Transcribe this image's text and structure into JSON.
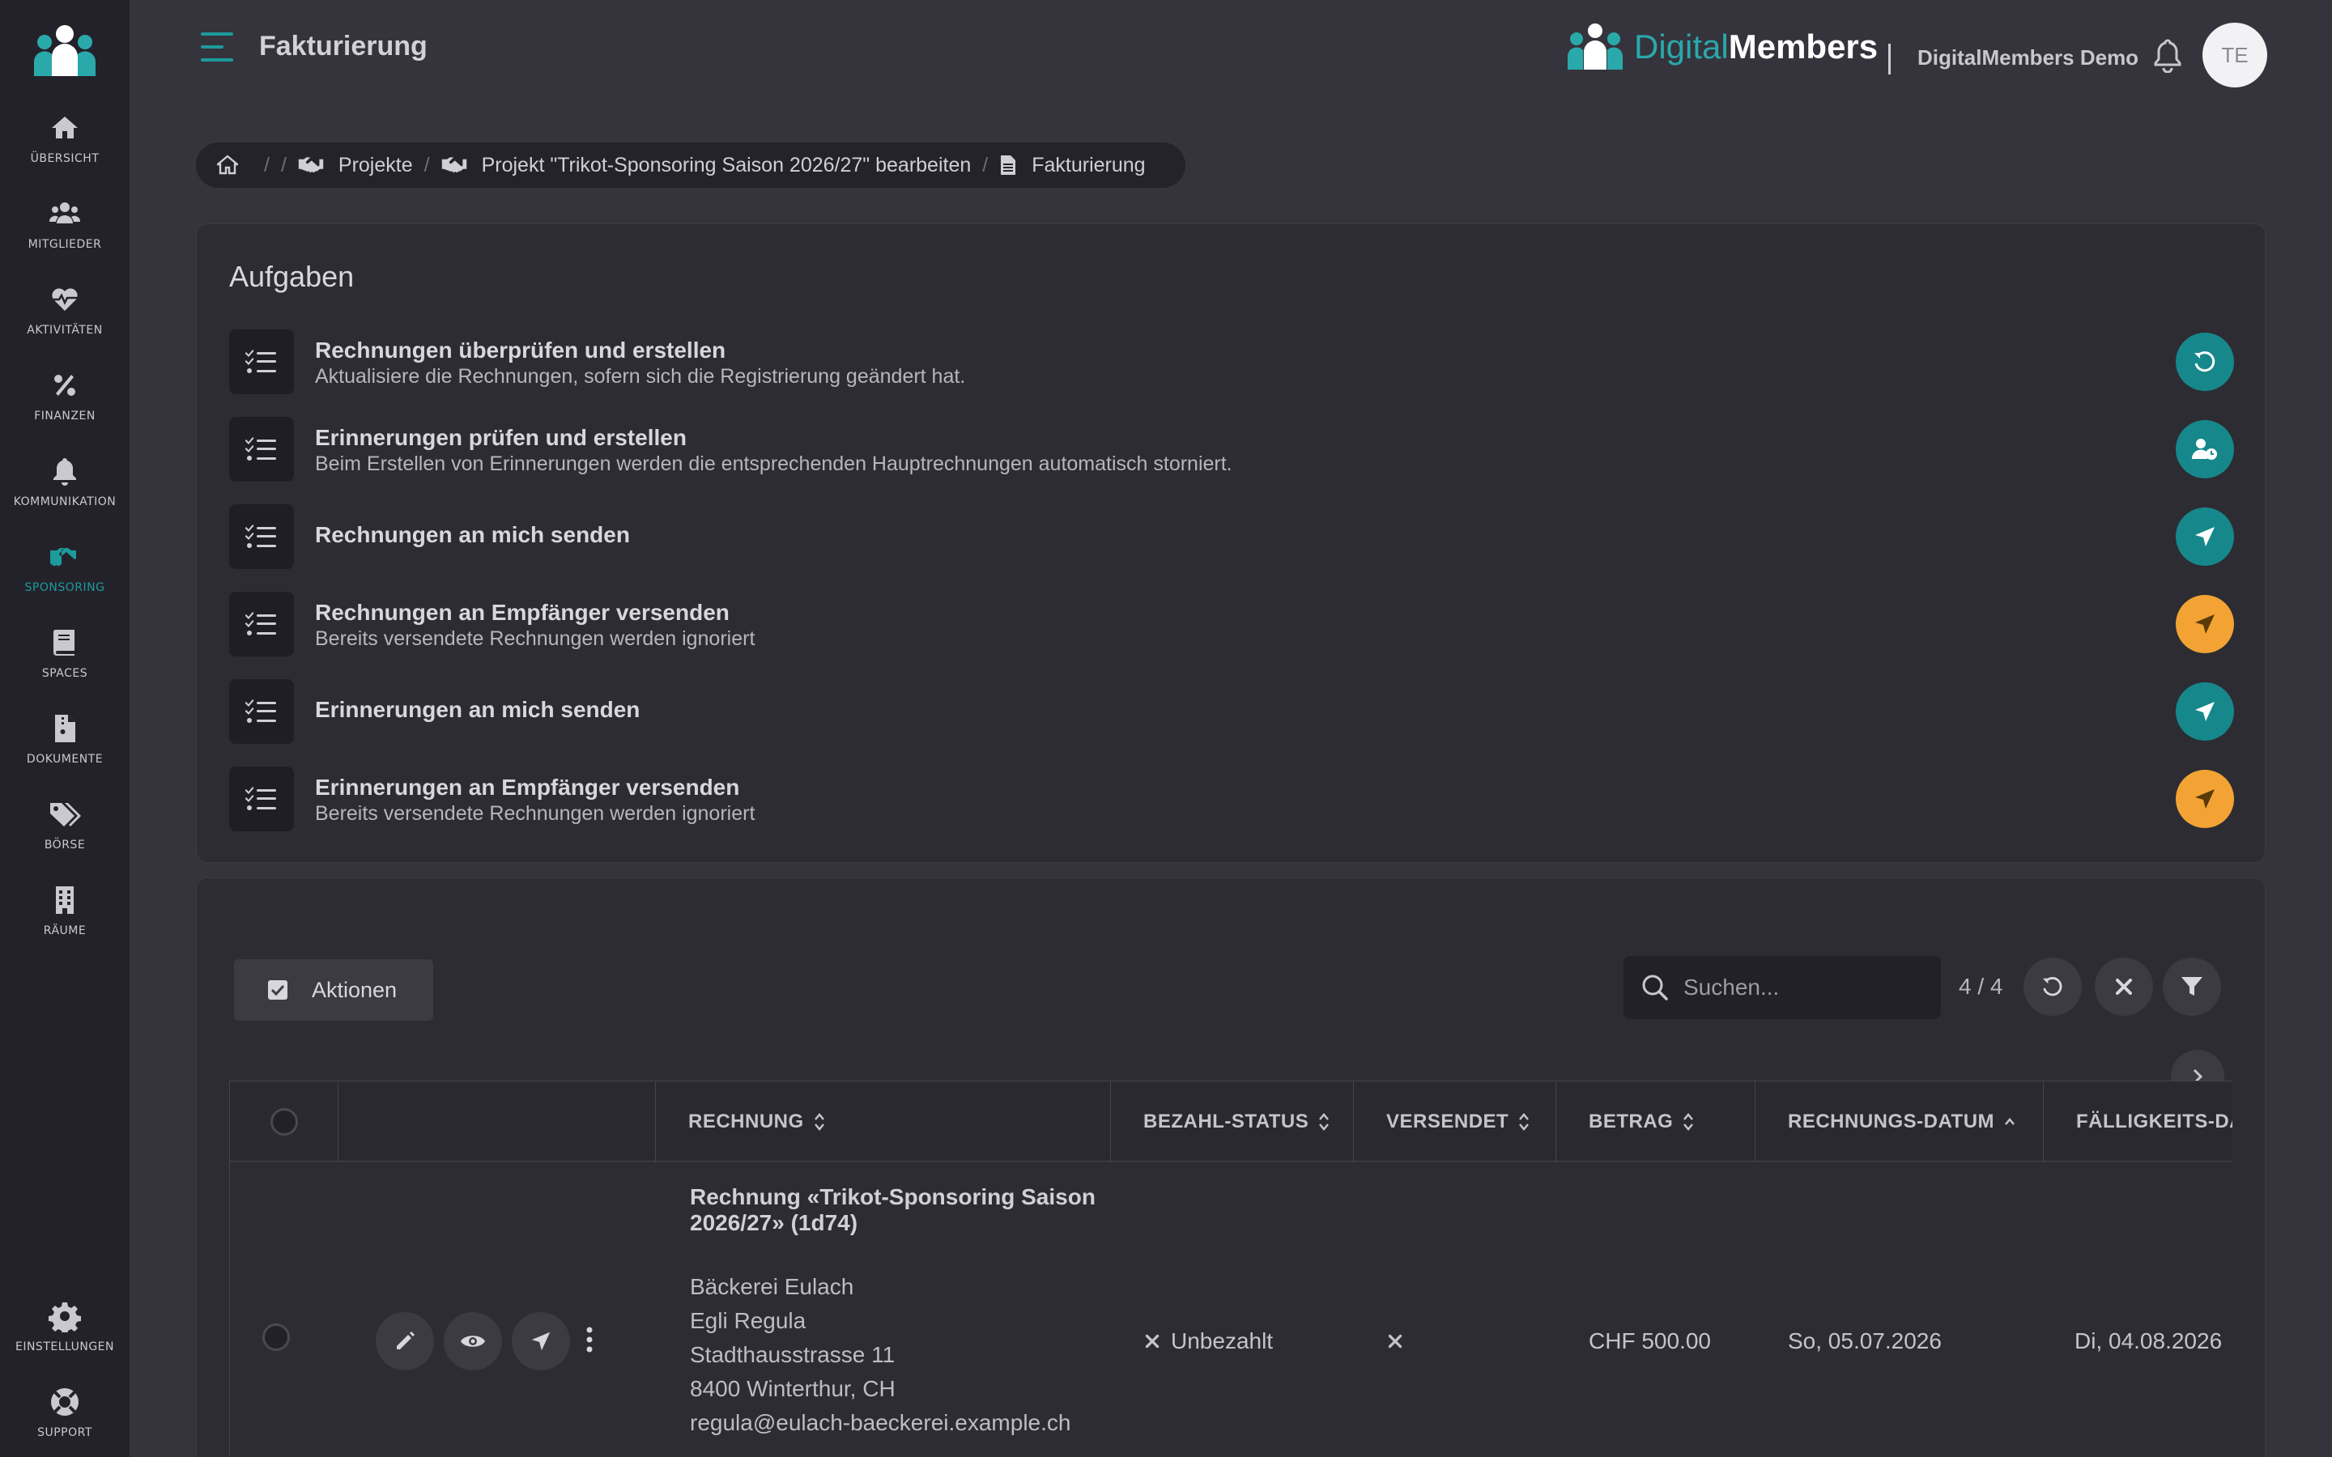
{
  "header": {
    "title": "Fakturierung",
    "brand_digital": "Digital",
    "brand_members": "Members",
    "org_name": "DigitalMembers Demo",
    "avatar_initials": "TE"
  },
  "sidebar": {
    "items": [
      {
        "label": "Übersicht",
        "icon": "home-icon"
      },
      {
        "label": "Mitglieder",
        "icon": "users-icon"
      },
      {
        "label": "Aktivitäten",
        "icon": "heartbeat-icon"
      },
      {
        "label": "Finanzen",
        "icon": "percent-icon"
      },
      {
        "label": "Kommunikation",
        "icon": "bell-icon"
      },
      {
        "label": "Sponsoring",
        "icon": "handshake-icon",
        "active": true
      },
      {
        "label": "Spaces",
        "icon": "book-icon"
      },
      {
        "label": "Dokumente",
        "icon": "file-icon"
      },
      {
        "label": "Börse",
        "icon": "tags-icon"
      },
      {
        "label": "Räume",
        "icon": "building-icon"
      },
      {
        "label": "Einstellungen",
        "icon": "gear-icon"
      },
      {
        "label": "Support",
        "icon": "lifebuoy-icon"
      }
    ],
    "active_color": "#1d9a9c"
  },
  "breadcrumb": {
    "items": [
      "Projekte",
      "Projekt \"Trikot-Sponsoring Saison 2026/27\" bearbeiten",
      "Fakturierung"
    ]
  },
  "tasks": {
    "title": "Aufgaben",
    "items": [
      {
        "title": "Rechnungen überprüfen und erstellen",
        "subtitle": "Aktualisiere die Rechnungen, sofern sich die Registrierung geändert hat.",
        "action_icon": "refresh-icon",
        "color": "#16888b"
      },
      {
        "title": "Erinnerungen prüfen und erstellen",
        "subtitle": "Beim Erstellen von Erinnerungen werden die entsprechenden Hauptrechnungen automatisch storniert.",
        "action_icon": "user-clock-icon",
        "color": "#16888b"
      },
      {
        "title": "Rechnungen an mich senden",
        "subtitle": "",
        "action_icon": "send-icon",
        "color": "#16888b"
      },
      {
        "title": "Rechnungen an Empfänger versenden",
        "subtitle": "Bereits versendete Rechnungen werden ignoriert",
        "action_icon": "send-icon",
        "color": "#f3a334"
      },
      {
        "title": "Erinnerungen an mich senden",
        "subtitle": "",
        "action_icon": "send-icon",
        "color": "#16888b"
      },
      {
        "title": "Erinnerungen an Empfänger versenden",
        "subtitle": "Bereits versendete Rechnungen werden ignoriert",
        "action_icon": "send-icon",
        "color": "#f3a334"
      }
    ]
  },
  "table": {
    "actions_label": "Aktionen",
    "search_placeholder": "Suchen...",
    "count": "4 / 4",
    "columns": [
      "RECHNUNG",
      "BEZAHL-STATUS",
      "VERSENDET",
      "BETRAG",
      "RECHNUNGS-DATUM",
      "FÄLLIGKEITS-DAT"
    ],
    "rows": [
      {
        "title": "Rechnung «Trikot-Sponsoring Saison 2026/27» (1d74)",
        "address": [
          "Bäckerei Eulach",
          "Egli Regula",
          "Stadthausstrasse 11",
          "8400 Winterthur, CH",
          "regula@eulach-baeckerei.example.ch"
        ],
        "status": "Unbezahlt",
        "amount": "CHF 500.00",
        "invoice_date": "So, 05.07.2026",
        "due_date": "Di, 04.08.2026"
      }
    ]
  }
}
